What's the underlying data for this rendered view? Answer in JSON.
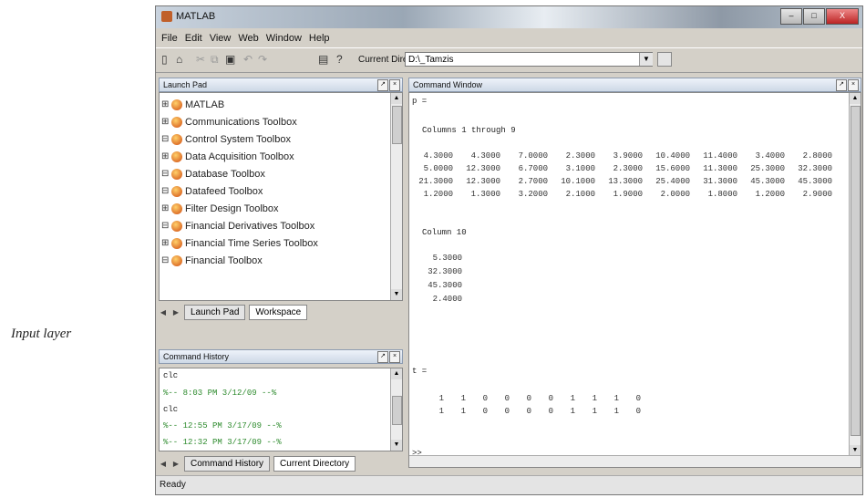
{
  "caption": "Input layer",
  "window": {
    "title": "MATLAB"
  },
  "window_buttons": {
    "minimize": "–",
    "maximize": "□",
    "close": "X"
  },
  "menu": [
    "File",
    "Edit",
    "View",
    "Web",
    "Window",
    "Help"
  ],
  "toolbar": {
    "icons": [
      "new-file-icon",
      "open-file-icon",
      "cut-icon",
      "copy-icon",
      "paste-icon",
      "undo-icon",
      "redo-icon",
      "simulink-icon",
      "help-icon"
    ],
    "current_directory_label": "Current Directory:",
    "current_directory_value": "D:\\_Tamzis"
  },
  "launch_pad": {
    "title": "Launch Pad",
    "items": [
      {
        "expander": "⊞",
        "label": "MATLAB"
      },
      {
        "expander": "⊞",
        "label": "Communications Toolbox"
      },
      {
        "expander": "⊟",
        "label": "Control System Toolbox"
      },
      {
        "expander": "⊞",
        "label": "Data Acquisition Toolbox"
      },
      {
        "expander": "⊟",
        "label": "Database Toolbox"
      },
      {
        "expander": "⊟",
        "label": "Datafeed Toolbox"
      },
      {
        "expander": "⊞",
        "label": "Filter Design Toolbox"
      },
      {
        "expander": "⊟",
        "label": "Financial Derivatives Toolbox"
      },
      {
        "expander": "⊞",
        "label": "Financial Time Series Toolbox"
      },
      {
        "expander": "⊟",
        "label": "Financial Toolbox"
      }
    ],
    "tabs": [
      "Launch Pad",
      "Workspace"
    ]
  },
  "command_history": {
    "title": "Command History",
    "lines": [
      {
        "text": "clc",
        "color": "#222222"
      },
      {
        "text": "%-- 8:03 PM 3/12/09 --%",
        "color": "#2e8b2e"
      },
      {
        "text": "clc",
        "color": "#222222"
      },
      {
        "text": "%-- 12:55 PM 3/17/09 --%",
        "color": "#2e8b2e"
      },
      {
        "text": "%-- 12:32 PM 3/17/09 --%",
        "color": "#2e8b2e"
      }
    ],
    "tabs": [
      "Command History",
      "Current Directory"
    ]
  },
  "command_window": {
    "title": "Command Window",
    "var_p": "p =",
    "columns_header": "Columns 1 through 9",
    "matrix_p": [
      [
        "4.3000",
        "4.3000",
        "7.0000",
        "2.3000",
        "3.9000",
        "10.4000",
        "11.4000",
        "3.4000",
        "2.8000"
      ],
      [
        "5.0000",
        "12.3000",
        "6.7000",
        "3.1000",
        "2.3000",
        "15.6000",
        "11.3000",
        "25.3000",
        "32.3000"
      ],
      [
        "21.3000",
        "12.3000",
        "2.7000",
        "10.1000",
        "13.3000",
        "25.4000",
        "31.3000",
        "45.3000",
        "45.3000"
      ],
      [
        "1.2000",
        "1.3000",
        "3.2000",
        "2.1000",
        "1.9000",
        "2.0000",
        "1.8000",
        "1.2000",
        "2.9000"
      ]
    ],
    "column_10_header": "Column 10",
    "column_10": [
      "5.3000",
      "32.3000",
      "45.3000",
      "2.4000"
    ],
    "var_t": "t =",
    "vector_t": [
      [
        "1",
        "1",
        "0",
        "0",
        "0",
        "0",
        "1",
        "1",
        "1",
        "0"
      ],
      [
        "1",
        "1",
        "0",
        "0",
        "0",
        "0",
        "1",
        "1",
        "1",
        "0"
      ]
    ],
    "prompt": ">>"
  },
  "status": "Ready"
}
